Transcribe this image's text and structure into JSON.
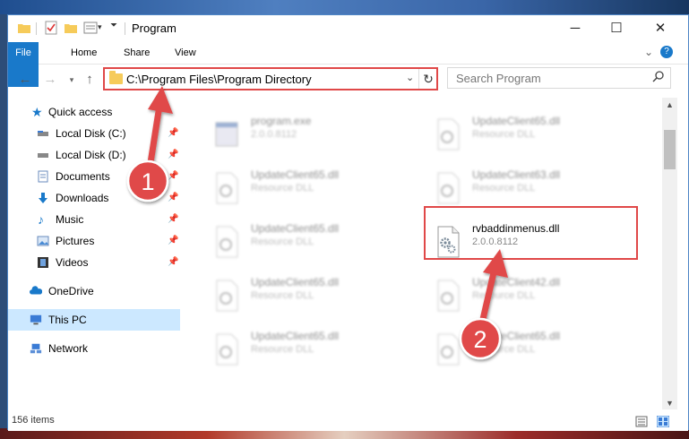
{
  "window": {
    "title": "Program",
    "minimize": "─",
    "maximize": "☐",
    "close": "✕",
    "help": "?",
    "ribbon_collapse": "⌄"
  },
  "ribbon": {
    "tabs": [
      "File",
      "Home",
      "Share",
      "View"
    ]
  },
  "address": {
    "path": "C:\\Program Files\\Program Directory",
    "search_placeholder": "Search Program"
  },
  "nav_pane": {
    "items": [
      {
        "label": "Quick access",
        "icon": "star-icon"
      },
      {
        "label": "Local Disk (C:)",
        "icon": "drive-icon",
        "pinned": true
      },
      {
        "label": "Local Disk (D:)",
        "icon": "drive-icon",
        "pinned": true
      },
      {
        "label": "Documents",
        "icon": "documents-icon",
        "pinned": true
      },
      {
        "label": "Downloads",
        "icon": "download-icon",
        "pinned": true
      },
      {
        "label": "Music",
        "icon": "music-icon",
        "pinned": true
      },
      {
        "label": "Pictures",
        "icon": "pictures-icon",
        "pinned": true
      },
      {
        "label": "Videos",
        "icon": "videos-icon",
        "pinned": true
      },
      {
        "label": "OneDrive",
        "icon": "cloud-icon"
      },
      {
        "label": "This PC",
        "icon": "computer-icon",
        "selected": true
      },
      {
        "label": "Network",
        "icon": "network-icon"
      }
    ]
  },
  "files": [
    {
      "name": "program.exe",
      "sub": "2.0.0.8112",
      "type": "exe"
    },
    {
      "name": "UpdateClient65.dll",
      "sub": "Resource DLL",
      "type": "dll"
    },
    {
      "name": "UpdateClient65.dll",
      "sub": "Resource DLL",
      "type": "dll"
    },
    {
      "name": "UpdateClient63.dll",
      "sub": "Resource DLL",
      "type": "dll"
    },
    {
      "name": "UpdateClient65.dll",
      "sub": "Resource DLL",
      "type": "dll"
    },
    {
      "name": "rvbaddinmenus.dll",
      "sub": "2.0.0.8112",
      "type": "dll",
      "highlighted": true
    },
    {
      "name": "UpdateClient65.dll",
      "sub": "Resource DLL",
      "type": "dll"
    },
    {
      "name": "UpdateClient42.dll",
      "sub": "Resource DLL",
      "type": "dll"
    },
    {
      "name": "UpdateClient65.dll",
      "sub": "Resource DLL",
      "type": "dll"
    },
    {
      "name": "UpdateClient65.dll",
      "sub": "Resource DLL",
      "type": "dll"
    }
  ],
  "status": {
    "count": "156 items"
  },
  "annotations": {
    "step1": "1",
    "step2": "2",
    "color": "#e04848"
  }
}
